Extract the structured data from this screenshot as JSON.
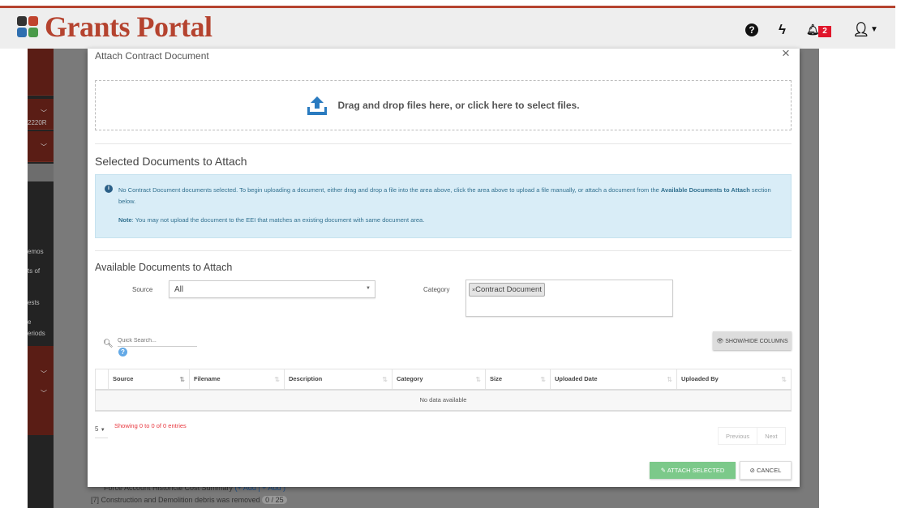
{
  "header": {
    "logo": "Grants Portal",
    "notification_count": "2",
    "icons": [
      "help-circle-icon",
      "bolt-icon",
      "bell-icon",
      "user-icon",
      "caret-down-icon"
    ],
    "brand_color": "#b5432f"
  },
  "background": {
    "sidebar_fragments": [
      "2220R",
      "emos",
      "ts of",
      "ests",
      "e",
      "eriods"
    ],
    "rows": [
      "Force Account Historical Cost Summary",
      "(+ Add  | + Add )",
      "[7]  Construction and Demolition debris was removed",
      "0 / 25"
    ]
  },
  "modal": {
    "title": "Attach Contract Document",
    "dropzone_text": "Drag and drop files here, or click here to select files.",
    "selected_heading": "Selected Documents to Attach",
    "info": {
      "text_1": "No Contract Document documents selected. To begin uploading a document, either drag and drop a file into the area above, click the area above to upload a file manually, or attach a document from the ",
      "bold_1": "Available Documents to Attach",
      "text_2": " section below.",
      "note_label": "Note",
      "note_text": ": You may not upload the document to the EEI that matches an existing document with same document area."
    },
    "available_heading": "Available Documents to Attach",
    "source_label": "Source",
    "source_value": "All",
    "category_label": "Category",
    "category_tags": [
      "Contract Document"
    ],
    "search_placeholder": "Quick Search...",
    "show_hide_label": "SHOW/HIDE COLUMNS",
    "table": {
      "columns": [
        "Source",
        "Filename",
        "Description",
        "Category",
        "Size",
        "Uploaded Date",
        "Uploaded By"
      ],
      "empty": "No data available"
    },
    "page_length": "5",
    "showing": "Showing 0 to 0 of 0 entries",
    "previous": "Previous",
    "next": "Next",
    "attach_label": "ATTACH SELECTED",
    "cancel_label": "CANCEL"
  }
}
